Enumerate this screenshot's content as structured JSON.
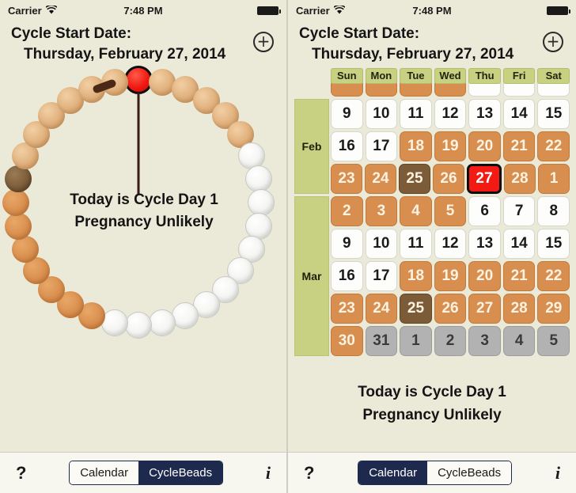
{
  "status_bar": {
    "carrier": "Carrier",
    "wifi_icon": "wifi-icon",
    "time": "7:48 PM",
    "battery_icon": "battery-full-icon"
  },
  "header": {
    "label": "Cycle Start Date:",
    "date": "Thursday, February 27, 2014",
    "add_button_icon": "plus-circle-icon"
  },
  "message": {
    "line1": "Today is Cycle Day 1",
    "line2": "Pregnancy Unlikely"
  },
  "toolbar": {
    "help_icon": "question-mark-icon",
    "info_icon": "info-icon",
    "segments": [
      "Calendar",
      "CycleBeads"
    ],
    "left_selected": "CycleBeads",
    "right_selected": "Calendar"
  },
  "colors": {
    "background": "#ebe9d8",
    "tan_bead": "#e0b07c",
    "orange_bead": "#d98f4e",
    "brown_bead": "#7c5e3b",
    "white_bead": "#f4f4f2",
    "today_red": "#f21a12",
    "header_green": "#c8d182",
    "grey_cell": "#b2b2b2",
    "segment_navy": "#1d2a4d"
  },
  "beads": {
    "count": 32,
    "marker_label": "cycle-start-marker",
    "today_index": 0,
    "sequence": [
      "red",
      "tan",
      "tan",
      "tan",
      "tan",
      "tan",
      "white",
      "white",
      "white",
      "white",
      "white",
      "white",
      "white",
      "white",
      "white",
      "white",
      "white",
      "white",
      "orange",
      "orange",
      "orange",
      "orange",
      "orange",
      "orange",
      "orange",
      "brown",
      "tan",
      "tan",
      "tan",
      "tan",
      "tan",
      "tan"
    ]
  },
  "calendar": {
    "day_headers": [
      "Sun",
      "Mon",
      "Tue",
      "Wed",
      "Thu",
      "Fri",
      "Sat"
    ],
    "months": [
      "Feb",
      "Mar"
    ],
    "clipped_row": {
      "values": [
        "",
        "",
        "",
        "",
        "",
        "",
        ""
      ],
      "styles": [
        "o",
        "o",
        "o",
        "o",
        "w",
        "w",
        "w"
      ]
    },
    "rows": [
      {
        "month": "Feb",
        "values": [
          "9",
          "10",
          "11",
          "12",
          "13",
          "14",
          "15"
        ],
        "styles": [
          "w",
          "w",
          "w",
          "w",
          "w",
          "w",
          "w"
        ]
      },
      {
        "month": "Feb",
        "values": [
          "16",
          "17",
          "18",
          "19",
          "20",
          "21",
          "22"
        ],
        "styles": [
          "w",
          "w",
          "o",
          "o",
          "o",
          "o",
          "o"
        ]
      },
      {
        "month": "Feb",
        "values": [
          "23",
          "24",
          "25",
          "26",
          "27",
          "28",
          "1"
        ],
        "styles": [
          "o",
          "o",
          "b",
          "o",
          "today",
          "o",
          "o"
        ]
      },
      {
        "month": "Mar",
        "values": [
          "2",
          "3",
          "4",
          "5",
          "6",
          "7",
          "8"
        ],
        "styles": [
          "o",
          "o",
          "o",
          "o",
          "w",
          "w",
          "w"
        ]
      },
      {
        "month": "Mar",
        "values": [
          "9",
          "10",
          "11",
          "12",
          "13",
          "14",
          "15"
        ],
        "styles": [
          "w",
          "w",
          "w",
          "w",
          "w",
          "w",
          "w"
        ]
      },
      {
        "month": "Mar",
        "values": [
          "16",
          "17",
          "18",
          "19",
          "20",
          "21",
          "22"
        ],
        "styles": [
          "w",
          "w",
          "o",
          "o",
          "o",
          "o",
          "o"
        ]
      },
      {
        "month": "Mar",
        "values": [
          "23",
          "24",
          "25",
          "26",
          "27",
          "28",
          "29"
        ],
        "styles": [
          "o",
          "o",
          "b",
          "o",
          "o",
          "o",
          "o"
        ]
      },
      {
        "month": "Mar",
        "values": [
          "30",
          "31",
          "1",
          "2",
          "3",
          "4",
          "5"
        ],
        "styles": [
          "o",
          "g",
          "g",
          "g",
          "g",
          "g",
          "g"
        ]
      }
    ]
  }
}
